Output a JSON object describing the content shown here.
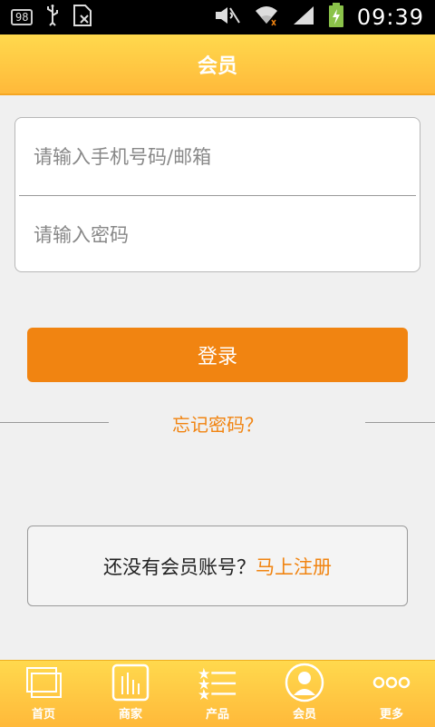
{
  "status_bar": {
    "notification_badge": "98",
    "time": "09:39"
  },
  "header": {
    "title": "会员"
  },
  "login": {
    "phone_placeholder": "请输入手机号码/邮箱",
    "password_placeholder": "请输入密码",
    "login_button": "登录",
    "forgot_password": "忘记密码？"
  },
  "register": {
    "prompt": "还没有会员账号？",
    "link": "马上注册"
  },
  "colors": {
    "accent": "#f18411",
    "header_top": "#ffd94d",
    "header_bottom": "#ffb93a"
  },
  "bottom_nav": {
    "items": [
      {
        "label": "首页",
        "icon": "home-icon"
      },
      {
        "label": "商家",
        "icon": "merchant-icon"
      },
      {
        "label": "产品",
        "icon": "product-list-icon"
      },
      {
        "label": "会员",
        "icon": "member-icon"
      },
      {
        "label": "更多",
        "icon": "more-icon"
      }
    ]
  }
}
